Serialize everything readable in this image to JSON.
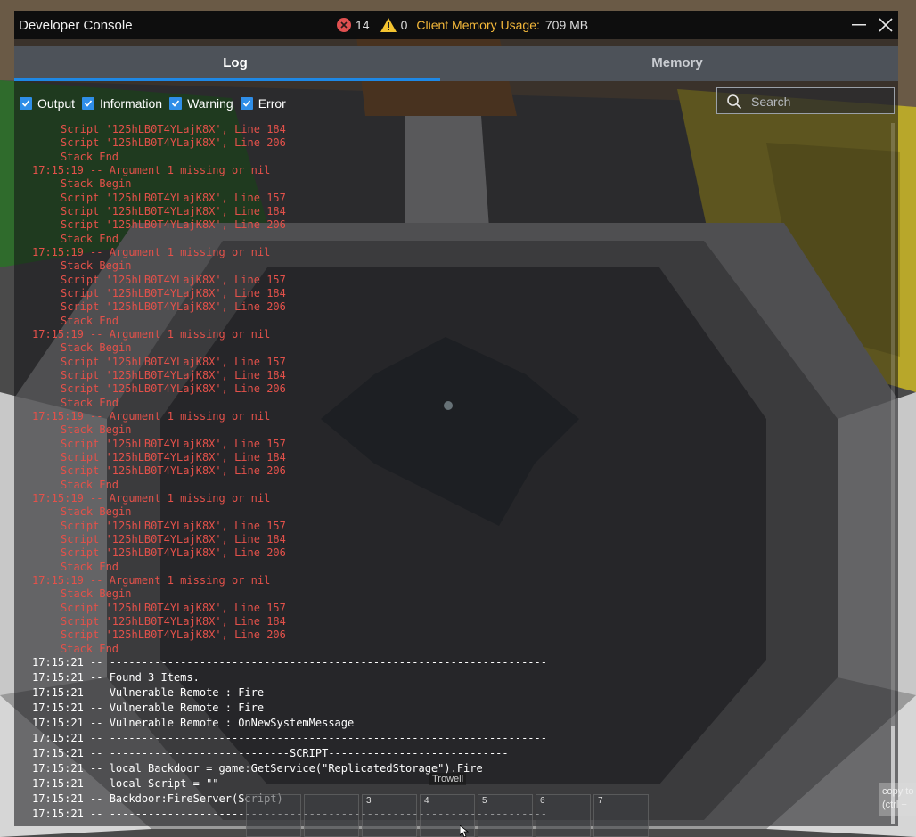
{
  "window": {
    "title": "Developer Console",
    "error_count": "14",
    "warning_count": "0",
    "memory_label": "Client Memory Usage:",
    "memory_value": "709 MB"
  },
  "icons": {
    "error": "error-circle-icon",
    "warning": "warning-triangle-icon",
    "minimize": "minimize-icon",
    "close": "close-icon",
    "search": "search-icon",
    "checkbox": "checkmark-icon"
  },
  "colors": {
    "accent": "#1e88e5",
    "error_text": "#e3514a",
    "output_text": "#ffffff",
    "memory_label": "#f4b83a"
  },
  "tabs": [
    {
      "label": "Log",
      "active": true
    },
    {
      "label": "Memory",
      "active": false
    }
  ],
  "filters": [
    {
      "label": "Output",
      "checked": true
    },
    {
      "label": "Information",
      "checked": true
    },
    {
      "label": "Warning",
      "checked": true
    },
    {
      "label": "Error",
      "checked": true
    }
  ],
  "search": {
    "placeholder": "Search",
    "value": ""
  },
  "log": {
    "lines": [
      {
        "text": "Script '125hLB0T4YLajK8X', Line 184",
        "type": "error",
        "indent": true
      },
      {
        "text": "Script '125hLB0T4YLajK8X', Line 206",
        "type": "error",
        "indent": true
      },
      {
        "text": "Stack End",
        "type": "error",
        "indent": true
      },
      {
        "text": "17:15:19 -- Argument 1 missing or nil",
        "type": "error",
        "indent": false
      },
      {
        "text": "Stack Begin",
        "type": "error",
        "indent": true
      },
      {
        "text": "Script '125hLB0T4YLajK8X', Line 157",
        "type": "error",
        "indent": true
      },
      {
        "text": "Script '125hLB0T4YLajK8X', Line 184",
        "type": "error",
        "indent": true
      },
      {
        "text": "Script '125hLB0T4YLajK8X', Line 206",
        "type": "error",
        "indent": true
      },
      {
        "text": "Stack End",
        "type": "error",
        "indent": true
      },
      {
        "text": "17:15:19 -- Argument 1 missing or nil",
        "type": "error",
        "indent": false
      },
      {
        "text": "Stack Begin",
        "type": "error",
        "indent": true
      },
      {
        "text": "Script '125hLB0T4YLajK8X', Line 157",
        "type": "error",
        "indent": true
      },
      {
        "text": "Script '125hLB0T4YLajK8X', Line 184",
        "type": "error",
        "indent": true
      },
      {
        "text": "Script '125hLB0T4YLajK8X', Line 206",
        "type": "error",
        "indent": true
      },
      {
        "text": "Stack End",
        "type": "error",
        "indent": true
      },
      {
        "text": "17:15:19 -- Argument 1 missing or nil",
        "type": "error",
        "indent": false
      },
      {
        "text": "Stack Begin",
        "type": "error",
        "indent": true
      },
      {
        "text": "Script '125hLB0T4YLajK8X', Line 157",
        "type": "error",
        "indent": true
      },
      {
        "text": "Script '125hLB0T4YLajK8X', Line 184",
        "type": "error",
        "indent": true
      },
      {
        "text": "Script '125hLB0T4YLajK8X', Line 206",
        "type": "error",
        "indent": true
      },
      {
        "text": "Stack End",
        "type": "error",
        "indent": true
      },
      {
        "text": "17:15:19 -- Argument 1 missing or nil",
        "type": "error",
        "indent": false
      },
      {
        "text": "Stack Begin",
        "type": "error",
        "indent": true
      },
      {
        "text": "Script '125hLB0T4YLajK8X', Line 157",
        "type": "error",
        "indent": true
      },
      {
        "text": "Script '125hLB0T4YLajK8X', Line 184",
        "type": "error",
        "indent": true
      },
      {
        "text": "Script '125hLB0T4YLajK8X', Line 206",
        "type": "error",
        "indent": true
      },
      {
        "text": "Stack End",
        "type": "error",
        "indent": true
      },
      {
        "text": "17:15:19 -- Argument 1 missing or nil",
        "type": "error",
        "indent": false
      },
      {
        "text": "Stack Begin",
        "type": "error",
        "indent": true
      },
      {
        "text": "Script '125hLB0T4YLajK8X', Line 157",
        "type": "error",
        "indent": true
      },
      {
        "text": "Script '125hLB0T4YLajK8X', Line 184",
        "type": "error",
        "indent": true
      },
      {
        "text": "Script '125hLB0T4YLajK8X', Line 206",
        "type": "error",
        "indent": true
      },
      {
        "text": "Stack End",
        "type": "error",
        "indent": true
      },
      {
        "text": "17:15:19 -- Argument 1 missing or nil",
        "type": "error",
        "indent": false
      },
      {
        "text": "Stack Begin",
        "type": "error",
        "indent": true
      },
      {
        "text": "Script '125hLB0T4YLajK8X', Line 157",
        "type": "error",
        "indent": true
      },
      {
        "text": "Script '125hLB0T4YLajK8X', Line 184",
        "type": "error",
        "indent": true
      },
      {
        "text": "Script '125hLB0T4YLajK8X', Line 206",
        "type": "error",
        "indent": true
      },
      {
        "text": "Stack End",
        "type": "error",
        "indent": true
      },
      {
        "text": "17:15:21 -- --------------------------------------------------------------------",
        "type": "output",
        "indent": false
      },
      {
        "text": "17:15:21 -- Found 3 Items.",
        "type": "output",
        "indent": false
      },
      {
        "text": "17:15:21 -- Vulnerable Remote : Fire",
        "type": "output",
        "indent": false
      },
      {
        "text": "17:15:21 -- Vulnerable Remote : Fire",
        "type": "output",
        "indent": false
      },
      {
        "text": "17:15:21 -- Vulnerable Remote : OnNewSystemMessage",
        "type": "output",
        "indent": false
      },
      {
        "text": "17:15:21 -- --------------------------------------------------------------------",
        "type": "output",
        "indent": false
      },
      {
        "text": "17:15:21 -- ----------------------------SCRIPT----------------------------",
        "type": "output",
        "indent": false
      },
      {
        "text": "17:15:21 -- local Backdoor = game:GetService(\"ReplicatedStorage\").Fire",
        "type": "output",
        "indent": false
      },
      {
        "text": "17:15:21 -- local Script = \"\"",
        "type": "output",
        "indent": false
      },
      {
        "text": "17:15:21 -- Backdoor:FireServer(Script)",
        "type": "output",
        "indent": false
      },
      {
        "text": "17:15:21 -- --------------------------------------------------------------------",
        "type": "output",
        "indent": false
      }
    ]
  },
  "hotbar": {
    "tooltip": "Trowell",
    "slots": [
      "",
      "",
      "3",
      "4",
      "5",
      "6",
      "7"
    ]
  },
  "copy_hint": [
    "copy to",
    "(ctrl +"
  ]
}
